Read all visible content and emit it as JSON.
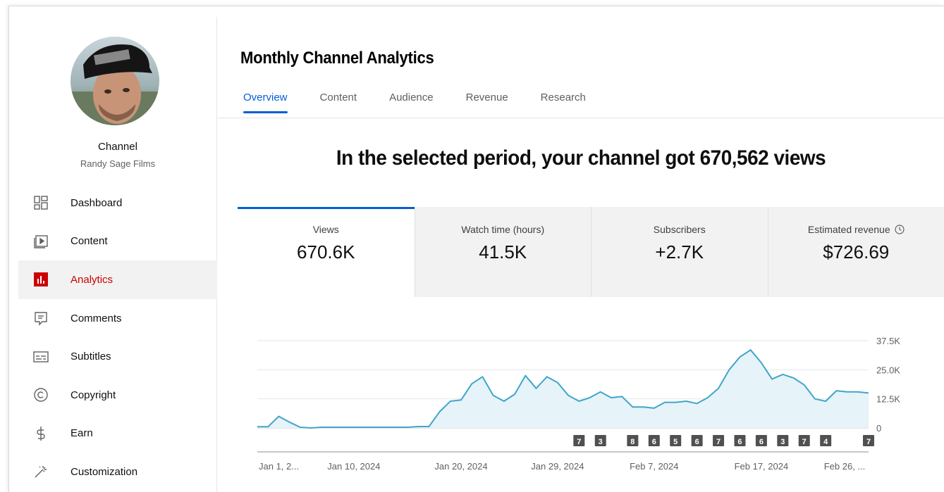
{
  "page": {
    "title": "Monthly Channel Analytics",
    "headline": "In the selected period, your channel got 670,562 views"
  },
  "sidebar": {
    "channel_title": "Channel",
    "channel_name": "Randy Sage Films",
    "items": [
      {
        "label": "Dashboard",
        "icon": "dashboard-icon",
        "active": false
      },
      {
        "label": "Content",
        "icon": "content-icon",
        "active": false
      },
      {
        "label": "Analytics",
        "icon": "analytics-icon",
        "active": true
      },
      {
        "label": "Comments",
        "icon": "comments-icon",
        "active": false
      },
      {
        "label": "Subtitles",
        "icon": "subtitles-icon",
        "active": false
      },
      {
        "label": "Copyright",
        "icon": "copyright-icon",
        "active": false
      },
      {
        "label": "Earn",
        "icon": "dollar-icon",
        "active": false
      },
      {
        "label": "Customization",
        "icon": "wand-icon",
        "active": false
      }
    ]
  },
  "tabs": [
    {
      "label": "Overview",
      "active": true
    },
    {
      "label": "Content",
      "active": false
    },
    {
      "label": "Audience",
      "active": false
    },
    {
      "label": "Revenue",
      "active": false
    },
    {
      "label": "Research",
      "active": false
    }
  ],
  "cards": [
    {
      "label": "Views",
      "value": "670.6K",
      "active": true
    },
    {
      "label": "Watch time (hours)",
      "value": "41.5K",
      "active": false
    },
    {
      "label": "Subscribers",
      "value": "+2.7K",
      "active": false
    },
    {
      "label": "Estimated revenue",
      "value": "$726.69",
      "active": false,
      "icon": "clock-icon"
    }
  ],
  "colors": {
    "accent": "#065fd4",
    "analytics_red": "#cc0000",
    "chart_line": "#41a5c9",
    "chart_fill": "#e6f3f8"
  },
  "chart_data": {
    "type": "area",
    "title": "",
    "xlabel": "",
    "ylabel": "",
    "ylim": [
      0,
      37500
    ],
    "y_ticks": [
      "37.5K",
      "25.0K",
      "12.5K",
      "0"
    ],
    "y_tick_values": [
      37500,
      25000,
      12500,
      0
    ],
    "x_tick_labels": [
      "Jan 1, 2...",
      "Jan 10, 2024",
      "Jan 20, 2024",
      "Jan 29, 2024",
      "Feb 7, 2024",
      "Feb 17, 2024",
      "Feb 26, ..."
    ],
    "x_tick_days": [
      1,
      10,
      20,
      29,
      38,
      48,
      57
    ],
    "x_days": [
      1,
      2,
      3,
      4,
      5,
      6,
      7,
      8,
      9,
      10,
      11,
      12,
      13,
      14,
      15,
      16,
      17,
      18,
      19,
      20,
      21,
      22,
      23,
      24,
      25,
      26,
      27,
      28,
      29,
      30,
      31,
      32,
      33,
      34,
      35,
      36,
      37,
      38,
      39,
      40,
      41,
      42,
      43,
      44,
      45,
      46,
      47,
      48,
      49,
      50,
      51,
      52,
      53,
      54,
      55,
      56,
      57,
      58
    ],
    "series": [
      {
        "values": [
          500,
          500,
          5000,
          2500,
          300,
          0,
          300,
          300,
          300,
          300,
          300,
          300,
          300,
          300,
          300,
          600,
          600,
          7000,
          11500,
          12000,
          19000,
          22000,
          14000,
          11500,
          14500,
          22500,
          17000,
          22000,
          19500,
          14000,
          11500,
          13000,
          15500,
          13000,
          13500,
          9000,
          9000,
          8500,
          11000,
          11000,
          11500,
          10500,
          13000,
          17000,
          25000,
          30500,
          33500,
          28000,
          21000,
          23000,
          21500,
          18500,
          12500,
          11500,
          16000,
          15500,
          15500,
          15000
        ]
      }
    ],
    "annotations": [
      {
        "day": 31,
        "label": "7"
      },
      {
        "day": 33,
        "label": "3"
      },
      {
        "day": 36,
        "label": "8"
      },
      {
        "day": 38,
        "label": "6"
      },
      {
        "day": 40,
        "label": "5"
      },
      {
        "day": 42,
        "label": "6"
      },
      {
        "day": 44,
        "label": "7"
      },
      {
        "day": 46,
        "label": "6"
      },
      {
        "day": 48,
        "label": "6"
      },
      {
        "day": 50,
        "label": "3"
      },
      {
        "day": 52,
        "label": "7"
      },
      {
        "day": 54,
        "label": "4"
      },
      {
        "day": 58,
        "label": "7"
      }
    ],
    "grid": true
  }
}
